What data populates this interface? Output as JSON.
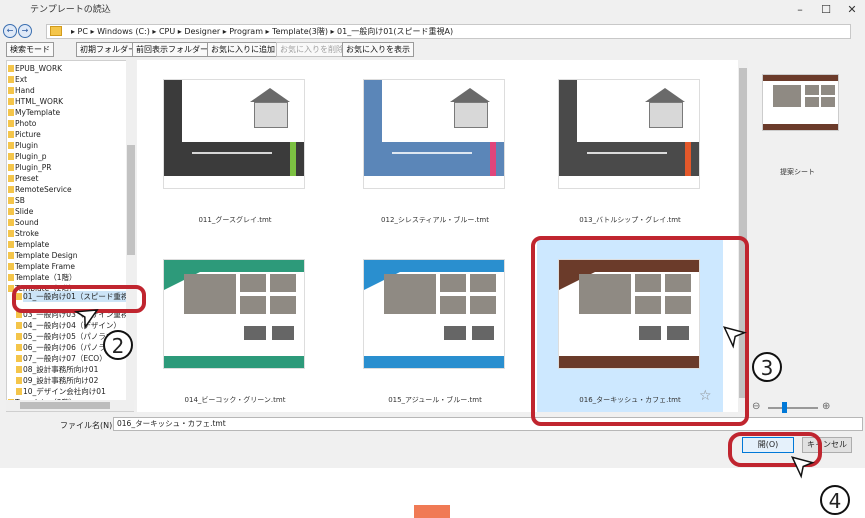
{
  "window": {
    "title": "テンプレートの読込",
    "minimize": "–",
    "maximize": "☐",
    "close": "✕"
  },
  "address": {
    "path": "▸ PC ▸ Windows (C:) ▸ CPU ▸ Designer ▸ Program ▸ Template(3階) ▸ 01_一般向け01(スピード重視A)",
    "back": "←",
    "forward": "→"
  },
  "toolbar": {
    "search_mode": "検索モード",
    "initial_folder": "初期フォルダー",
    "previous_folder": "前回表示フォルダー",
    "add_favorite": "お気に入りに追加",
    "remove_favorite": "お気に入りを削除",
    "show_favorites": "お気に入りを表示"
  },
  "tree": {
    "items": [
      "EPUB_WORK",
      "Ext",
      "Hand",
      "HTML_WORK",
      "MyTemplate",
      "Photo",
      "Picture",
      "Plugin",
      "Plugin_p",
      "Plugin_PR",
      "Preset",
      "RemoteService",
      "SB",
      "Slide",
      "Sound",
      "Stroke",
      "Template",
      "Template Design",
      "Template Frame",
      "Template（1階）",
      "Template（2階）"
    ],
    "selected": "01_一般向け01（スピード重視A）",
    "sub_items": [
      "03_一般向け03（デザイン重視C）",
      "04_一般向け04（デザイン）",
      "05_一般向け05（パノラマ）",
      "06_一般向け06（パノラマ）",
      "07_一般向け07（ECO）",
      "08_設計事務所向け01",
      "09_設計事務所向け02",
      "10_デザイン会社向け01"
    ],
    "bottom": "Template（3階）"
  },
  "files": [
    {
      "name": "011_グースグレイ.tmt",
      "bar": "#3b3b3b",
      "accent": "#7cc142"
    },
    {
      "name": "012_シレスティアル・ブルー.tmt",
      "bar": "#5b86b8",
      "accent": "#e0457b"
    },
    {
      "name": "013_バトルシップ・グレイ.tmt",
      "bar": "#4a4a4a",
      "accent": "#e4582a"
    },
    {
      "name": "014_ビーコック・グリーン.tmt",
      "bar": "#2d9a7a",
      "accent": "#2d9a7a"
    },
    {
      "name": "015_アジュール・ブルー.tmt",
      "bar": "#2a8fcf",
      "accent": "#2a8fcf"
    },
    {
      "name": "016_ターキッシュ・カフェ.tmt",
      "bar": "#6b3b2a",
      "accent": "#6b3b2a"
    }
  ],
  "thumb_text": "男男 太郎 様邸 ご提案",
  "preview": {
    "label": "提案シート"
  },
  "filename": {
    "label": "ファイル名(N):",
    "value": "016_ターキッシュ・カフェ.tmt"
  },
  "buttons": {
    "open": "開(O)",
    "cancel": "キャンセル"
  },
  "callouts": [
    "2",
    "3",
    "4"
  ],
  "colors": {
    "highlight": "#c0252f",
    "selection": "#cde8ff",
    "orange_tab": "#f07a55"
  }
}
